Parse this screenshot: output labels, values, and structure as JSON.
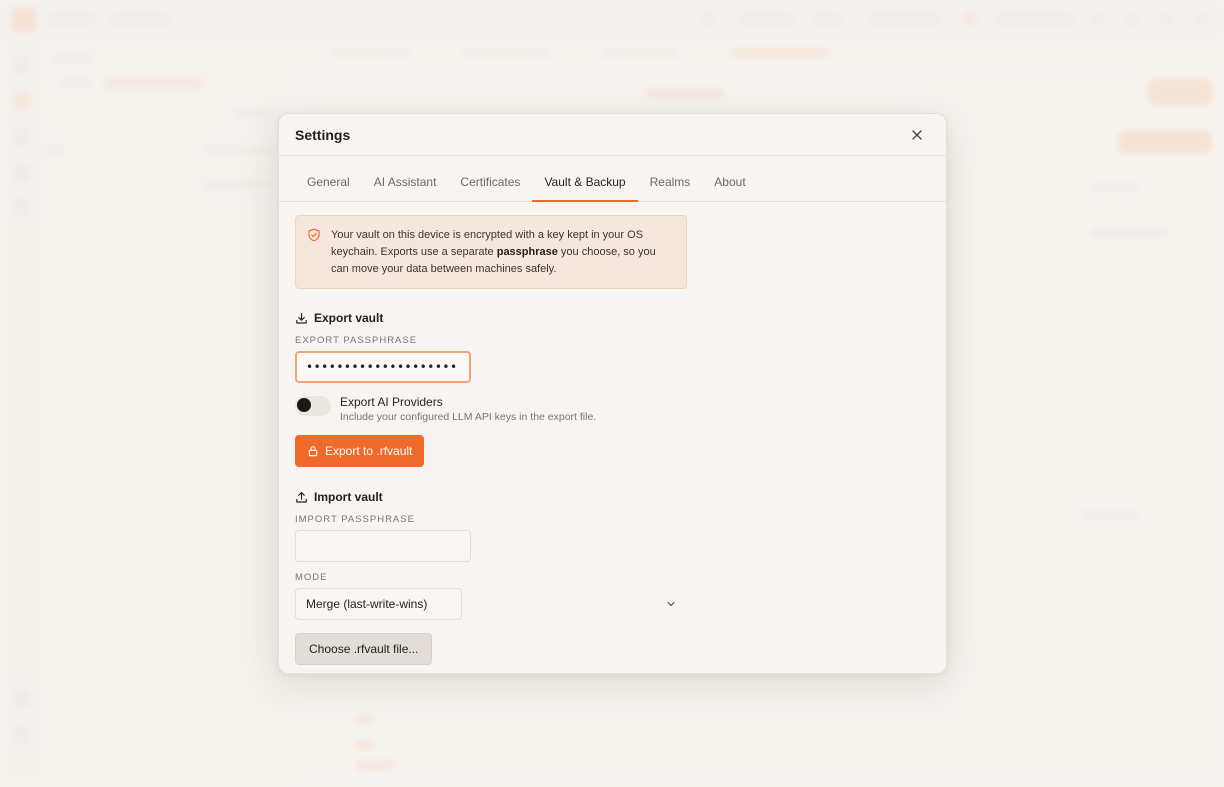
{
  "modal": {
    "title": "Settings",
    "close_icon": "close-icon"
  },
  "tabs": [
    {
      "label": "General",
      "active": false
    },
    {
      "label": "AI Assistant",
      "active": false
    },
    {
      "label": "Certificates",
      "active": false
    },
    {
      "label": "Vault & Backup",
      "active": true
    },
    {
      "label": "Realms",
      "active": false
    },
    {
      "label": "About",
      "active": false
    }
  ],
  "info": {
    "icon": "shield-check-icon",
    "text_before": "Your vault on this device is encrypted with a key kept in your OS keychain. Exports use a separate ",
    "text_bold": "passphrase",
    "text_after": " you choose, so you can move your data between machines safely."
  },
  "export": {
    "icon": "download-icon",
    "title": "Export vault",
    "passphrase_label": "Export passphrase",
    "passphrase_value": "••••••••••••••••••••",
    "toggle_title": "Export AI Providers",
    "toggle_subtitle": "Include your configured LLM API keys in the export file.",
    "toggle_on": false,
    "button_icon": "lock-icon",
    "button_label": "Export to .rfvault"
  },
  "import": {
    "icon": "upload-icon",
    "title": "Import vault",
    "passphrase_label": "Import passphrase",
    "passphrase_value": "",
    "mode_label": "Mode",
    "mode_value": "Merge (last-write-wins)",
    "button_label": "Choose .rfvault file..."
  },
  "colors": {
    "accent": "#ef6a2b",
    "info_bg": "#f6e7de",
    "focus_ring": "#f2a37b"
  }
}
